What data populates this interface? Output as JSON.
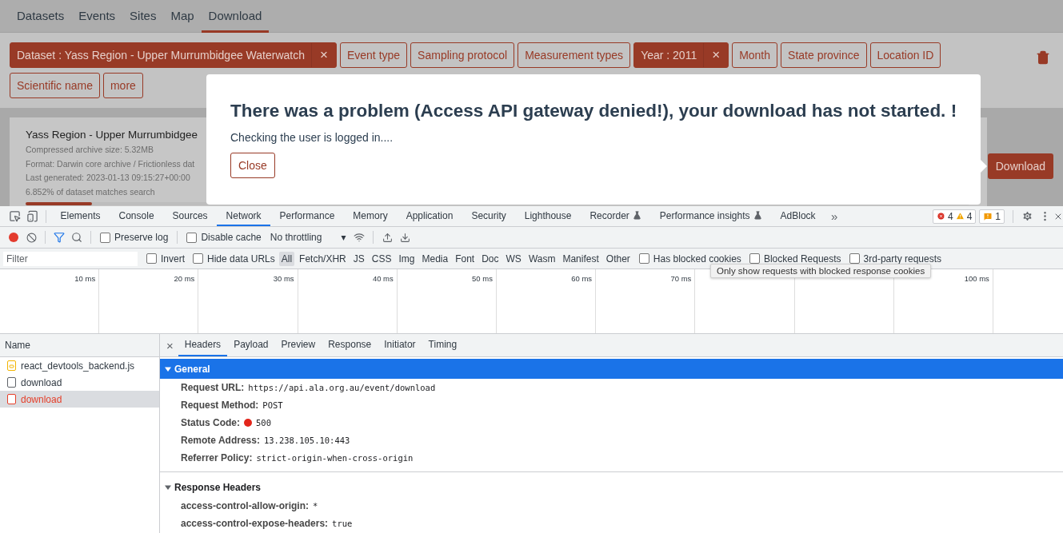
{
  "site_nav": {
    "tabs": [
      {
        "label": "Datasets",
        "selected": false
      },
      {
        "label": "Events",
        "selected": false
      },
      {
        "label": "Sites",
        "selected": false
      },
      {
        "label": "Map",
        "selected": false
      },
      {
        "label": "Download",
        "selected": true
      }
    ]
  },
  "filters": {
    "chips": [
      {
        "label": "Dataset : Yass Region - Upper Murrumbidgee Waterwatch",
        "active": true,
        "remove": "×"
      },
      {
        "label": "Event type",
        "active": false
      },
      {
        "label": "Sampling protocol",
        "active": false
      },
      {
        "label": "Measurement types",
        "active": false
      },
      {
        "label": "Year : 2011",
        "active": true,
        "remove": "×"
      },
      {
        "label": "Month",
        "active": false
      },
      {
        "label": "State province",
        "active": false
      },
      {
        "label": "Location ID",
        "active": false
      },
      {
        "label": "Scientific name",
        "active": false
      },
      {
        "label": "more",
        "active": false
      }
    ]
  },
  "dataset_card": {
    "title": "Yass Region - Upper Murrumbidgee",
    "lines": [
      "Compressed archive size: 5.32MB",
      "Format: Darwin core archive / Frictionless dat",
      "Last generated: 2023-01-13 09:15:27+00:00",
      "6.852% of dataset matches search"
    ],
    "level": 0.07,
    "button": "Download"
  },
  "dialog": {
    "title": "There was a problem (Access API gateway denied!), your download has not started. !",
    "message": "Checking the user is logged in....",
    "button": "Close"
  },
  "devtools": {
    "tabs": [
      {
        "label": "Elements",
        "selected": false,
        "experimental": false
      },
      {
        "label": "Console",
        "selected": false,
        "experimental": false
      },
      {
        "label": "Sources",
        "selected": false,
        "experimental": false
      },
      {
        "label": "Network",
        "selected": true,
        "experimental": false
      },
      {
        "label": "Performance",
        "selected": false,
        "experimental": false
      },
      {
        "label": "Memory",
        "selected": false,
        "experimental": false
      },
      {
        "label": "Application",
        "selected": false,
        "experimental": false
      },
      {
        "label": "Security",
        "selected": false,
        "experimental": false
      },
      {
        "label": "Lighthouse",
        "selected": false,
        "experimental": false
      },
      {
        "label": "Recorder",
        "selected": false,
        "experimental": true
      },
      {
        "label": "Performance insights",
        "selected": false,
        "experimental": true
      },
      {
        "label": "AdBlock",
        "selected": false,
        "experimental": false
      }
    ],
    "more_tabs": "»",
    "counts": {
      "errors": "4",
      "warnings": "4",
      "issues": "1"
    }
  },
  "toolbar": {
    "recording": true,
    "filter_active": true,
    "preserve_log": {
      "label": "Preserve log",
      "checked": false
    },
    "disable_cache": {
      "label": "Disable cache",
      "checked": false
    },
    "throttling": "No throttling",
    "throttling_caret": "▾"
  },
  "filter_bar": {
    "placeholder": "Filter",
    "invert": {
      "label": "Invert",
      "checked": false
    },
    "hide_data_urls": {
      "label": "Hide data URLs",
      "checked": false
    },
    "types": [
      {
        "label": "All",
        "selected": true
      },
      {
        "label": "Fetch/XHR",
        "selected": false
      },
      {
        "label": "JS",
        "selected": false
      },
      {
        "label": "CSS",
        "selected": false
      },
      {
        "label": "Img",
        "selected": false
      },
      {
        "label": "Media",
        "selected": false
      },
      {
        "label": "Font",
        "selected": false
      },
      {
        "label": "Doc",
        "selected": false
      },
      {
        "label": "WS",
        "selected": false
      },
      {
        "label": "Wasm",
        "selected": false
      },
      {
        "label": "Manifest",
        "selected": false
      },
      {
        "label": "Other",
        "selected": false
      }
    ],
    "extra": [
      {
        "label": "Has blocked cookies",
        "checked": false
      },
      {
        "label": "Blocked Requests",
        "checked": false
      },
      {
        "label": "3rd-party requests",
        "checked": false
      }
    ]
  },
  "tooltip": "Only show requests with blocked response cookies",
  "timeline": {
    "columns": [
      {
        "label": "10 ms"
      },
      {
        "label": "20 ms"
      },
      {
        "label": "30 ms"
      },
      {
        "label": "40 ms"
      },
      {
        "label": "50 ms"
      },
      {
        "label": "60 ms"
      },
      {
        "label": "70 ms"
      },
      {},
      {},
      {
        "label": "100 ms"
      }
    ]
  },
  "requests": {
    "header": "Name",
    "rows": [
      {
        "name": "react_devtools_backend.js",
        "kind": "script",
        "failed": false,
        "selected": false
      },
      {
        "name": "download",
        "kind": "document",
        "failed": false,
        "selected": false
      },
      {
        "name": "download",
        "kind": "document",
        "failed": true,
        "selected": true
      }
    ]
  },
  "details": {
    "close": "×",
    "tabs": [
      {
        "label": "Headers",
        "selected": true
      },
      {
        "label": "Payload",
        "selected": false
      },
      {
        "label": "Preview",
        "selected": false
      },
      {
        "label": "Response",
        "selected": false
      },
      {
        "label": "Initiator",
        "selected": false
      },
      {
        "label": "Timing",
        "selected": false
      }
    ],
    "sections": [
      {
        "title": "General",
        "expanded": true,
        "highlighted": true,
        "rows": [
          {
            "key": "Request URL:",
            "value": "https://api.ala.org.au/event/download"
          },
          {
            "key": "Request Method:",
            "value": "POST"
          },
          {
            "key": "Status Code:",
            "value": "500",
            "status_dot": true
          },
          {
            "key": "Remote Address:",
            "value": "13.238.105.10:443"
          },
          {
            "key": "Referrer Policy:",
            "value": "strict-origin-when-cross-origin"
          }
        ]
      },
      {
        "title": "Response Headers",
        "expanded": true,
        "highlighted": false,
        "rows": [
          {
            "key": "access-control-allow-origin:",
            "value": "*"
          },
          {
            "key": "access-control-expose-headers:",
            "value": "true"
          }
        ]
      }
    ]
  }
}
